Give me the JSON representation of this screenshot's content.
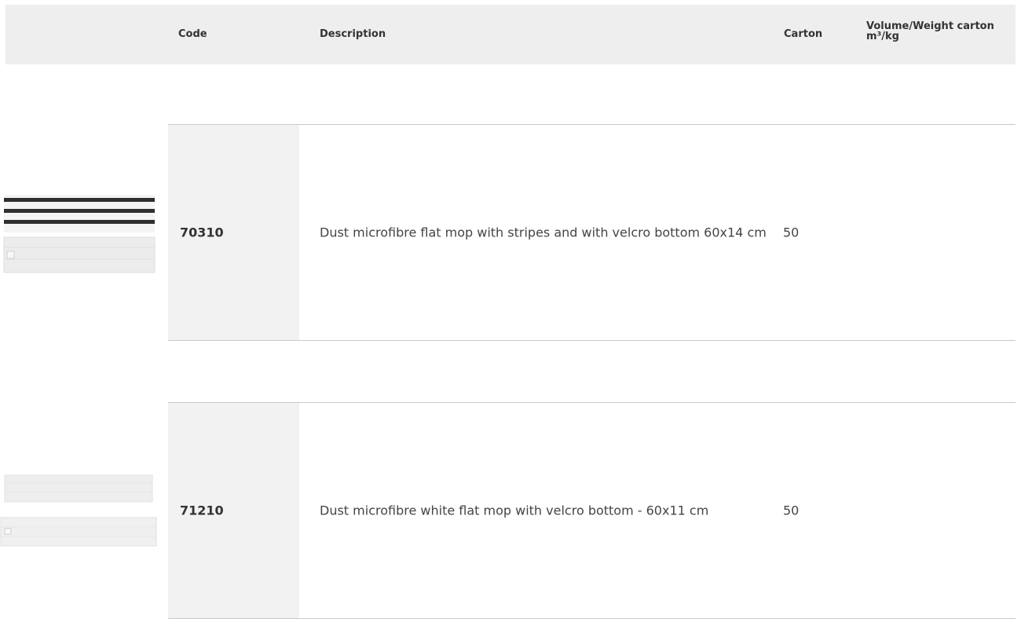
{
  "table": {
    "headers": {
      "code": "Code",
      "description": "Description",
      "carton": "Carton",
      "volume_line1": "Volume/Weight carton",
      "volume_line2": "m³/kg"
    },
    "rows": [
      {
        "code": "70310",
        "description": "Dust microfibre flat mop with stripes and with velcro bottom 60x14 cm",
        "carton": "50",
        "volume_weight": "",
        "image_icon": "striped-mop-pad-image"
      },
      {
        "code": "71210",
        "description": "Dust microfibre white flat mop with velcro bottom - 60x11 cm",
        "carton": "50",
        "volume_weight": "",
        "image_icon": "white-mop-pad-image"
      }
    ]
  },
  "colors": {
    "header_bg": "#eeeeee",
    "code_cell_bg": "#f2f2f2",
    "row_border": "#c8c8c8",
    "text": "#333333"
  }
}
